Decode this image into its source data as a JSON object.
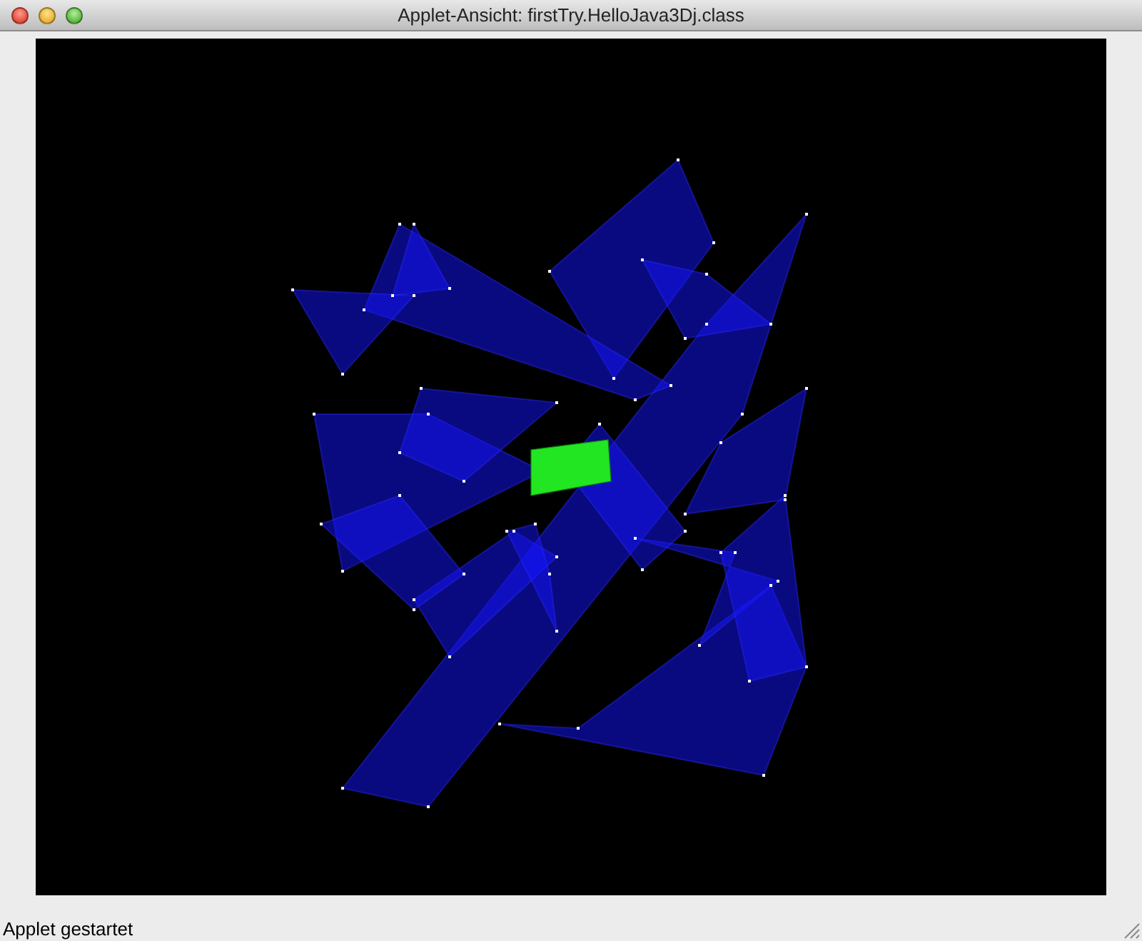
{
  "window": {
    "title": "Applet-Ansicht: firstTry.HelloJava3Dj.class"
  },
  "status_bar": {
    "text": "Applet gestartet"
  }
}
